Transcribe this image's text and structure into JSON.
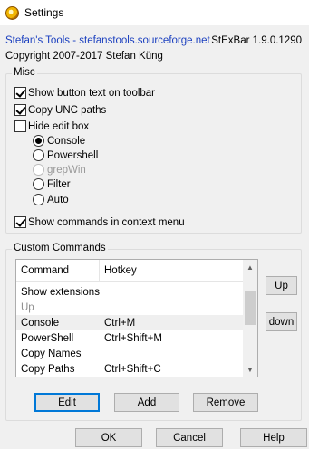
{
  "window": {
    "title": "Settings"
  },
  "header": {
    "link": "Stefan's Tools - stefanstools.sourceforge.net",
    "version": "StExBar 1.9.0.1290",
    "copyright": "Copyright 2007-2017 Stefan Küng"
  },
  "misc": {
    "legend": "Misc",
    "show_button_text": {
      "label": "Show button text on toolbar",
      "checked": true
    },
    "copy_unc": {
      "label": "Copy UNC paths",
      "checked": true
    },
    "hide_edit_box": {
      "label": "Hide edit box",
      "checked": false
    },
    "radios": [
      {
        "label": "Console",
        "checked": true,
        "enabled": true
      },
      {
        "label": "Powershell",
        "checked": false,
        "enabled": true
      },
      {
        "label": "grepWin",
        "checked": false,
        "enabled": false
      },
      {
        "label": "Filter",
        "checked": false,
        "enabled": true
      },
      {
        "label": "Auto",
        "checked": false,
        "enabled": true
      }
    ],
    "show_commands": {
      "label": "Show commands in context menu",
      "checked": true
    }
  },
  "custom_commands": {
    "legend": "Custom Commands",
    "columns": [
      "Command",
      "Hotkey"
    ],
    "rows": [
      {
        "command": "Show extensions",
        "hotkey": ""
      },
      {
        "command": "Up",
        "hotkey": ""
      },
      {
        "command": "Console",
        "hotkey": "Ctrl+M"
      },
      {
        "command": "PowerShell",
        "hotkey": "Ctrl+Shift+M"
      },
      {
        "command": "Copy Names",
        "hotkey": ""
      },
      {
        "command": "Copy Paths",
        "hotkey": "Ctrl+Shift+C"
      }
    ],
    "up_button": "Up",
    "down_button": "down",
    "edit_button": "Edit",
    "add_button": "Add",
    "remove_button": "Remove"
  },
  "footer": {
    "ok": "OK",
    "cancel": "Cancel",
    "help": "Help"
  },
  "colors": {
    "link": "#1a3fbf",
    "default_button_border": "#0078d7",
    "window_bg": "#f0f0f0"
  }
}
